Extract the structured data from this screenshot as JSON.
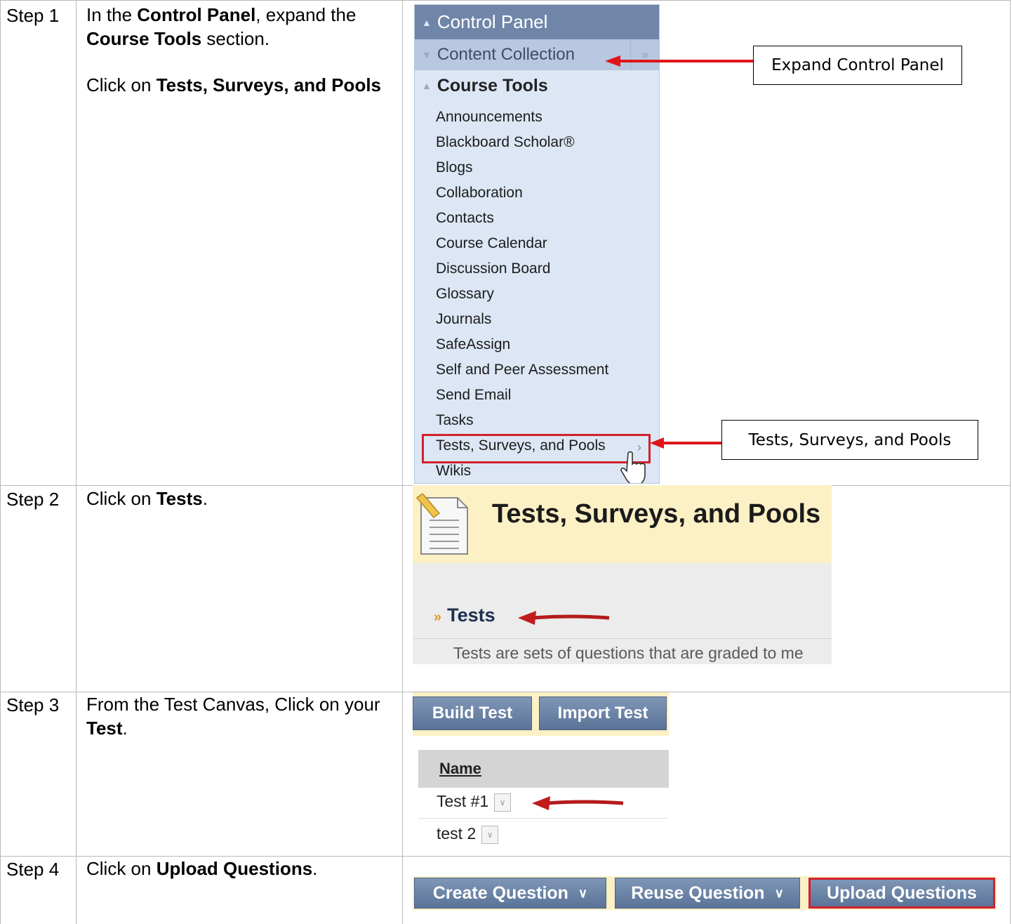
{
  "steps": [
    {
      "label": "Step 1",
      "lines": [
        {
          "segments": [
            {
              "t": "In the ",
              "b": false
            },
            {
              "t": "Control Panel",
              "b": true
            },
            {
              "t": ", expand the ",
              "b": false
            },
            {
              "t": "Course Tools",
              "b": true
            },
            {
              "t": " section.",
              "b": false
            }
          ]
        },
        {
          "segments": [
            {
              "t": "Click on ",
              "b": false
            },
            {
              "t": "Tests, Surveys, and Pools",
              "b": true
            }
          ]
        }
      ]
    },
    {
      "label": "Step 2",
      "lines": [
        {
          "segments": [
            {
              "t": "Click on ",
              "b": false
            },
            {
              "t": "Tests",
              "b": true
            },
            {
              "t": ".",
              "b": false
            }
          ]
        }
      ]
    },
    {
      "label": "Step 3",
      "lines": [
        {
          "segments": [
            {
              "t": "From the Test Canvas, Click on your ",
              "b": false
            },
            {
              "t": "Test",
              "b": true
            },
            {
              "t": ".",
              "b": false
            }
          ]
        }
      ]
    },
    {
      "label": "Step 4",
      "lines": [
        {
          "segments": [
            {
              "t": "Click on ",
              "b": false
            },
            {
              "t": "Upload Questions",
              "b": true
            },
            {
              "t": ".",
              "b": false
            }
          ]
        }
      ]
    }
  ],
  "control_panel": {
    "title": "Control Panel",
    "content_collection": "Content Collection",
    "course_tools": "Course Tools",
    "items": [
      "Announcements",
      "Blackboard Scholar®",
      "Blogs",
      "Collaboration",
      "Contacts",
      "Course Calendar",
      "Discussion Board",
      "Glossary",
      "Journals",
      "SafeAssign",
      "Self and Peer Assessment",
      "Send Email",
      "Tasks",
      "Tests, Surveys, and Pools",
      "Wikis"
    ],
    "selected_index": 13
  },
  "callouts": {
    "expand": "Expand Control Panel",
    "tsp": "Tests, Surveys, and Pools"
  },
  "tests_page": {
    "title": "Tests, Surveys, and Pools",
    "tests_link": "Tests",
    "description": "Tests are sets of questions that are graded to me"
  },
  "test_canvas": {
    "build_button": "Build Test",
    "import_button": "Import Test",
    "name_header": "Name",
    "rows": [
      "Test #1",
      "test 2"
    ]
  },
  "upload_bar": {
    "create_button": "Create Question",
    "reuse_button": "Reuse Question",
    "upload_button": "Upload Questions"
  },
  "colors": {
    "panel_header": "#6f86a8",
    "highlight_red": "#d3202e",
    "yellow_bar": "#fcf0c5"
  }
}
